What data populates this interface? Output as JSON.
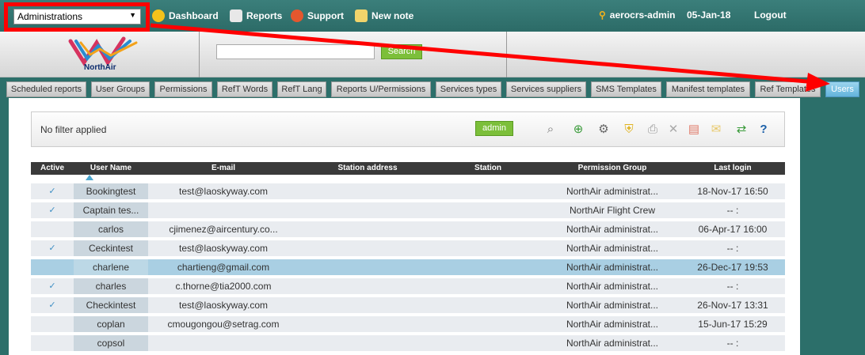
{
  "topbar": {
    "module_select": "Administrations",
    "dashboard": "Dashboard",
    "reports": "Reports",
    "support": "Support",
    "new_note": "New note",
    "user": "aerocrs-admin",
    "date": "05-Jan-18",
    "logout": "Logout"
  },
  "logo": {
    "brand": "NorthAir"
  },
  "search": {
    "button": "Search"
  },
  "tabs": [
    "Scheduled reports",
    "User Groups",
    "Permissions",
    "RefT Words",
    "RefT Lang",
    "Reports U/Permissions",
    "Services types",
    "Services suppliers",
    "SMS Templates",
    "Manifest templates",
    "Ref Templates",
    "Users"
  ],
  "filter": {
    "text": "No filter applied",
    "admin_button": "admin"
  },
  "table": {
    "headers": [
      "Active",
      "User Name",
      "E-mail",
      "Station address",
      "Station",
      "Permission Group",
      "Last login"
    ],
    "rows": [
      {
        "active": "✓",
        "user": "Bookingtest",
        "email": "test@laoskyway.com",
        "group": "NorthAir administrat...",
        "last": "18-Nov-17 16:50"
      },
      {
        "active": "✓",
        "user": "Captain tes...",
        "email": "",
        "group": "NorthAir Flight Crew",
        "last": "-- :"
      },
      {
        "active": "",
        "user": "carlos",
        "email": "cjimenez@aircentury.co...",
        "group": "NorthAir administrat...",
        "last": "06-Apr-17 16:00"
      },
      {
        "active": "✓",
        "user": "Ceckintest",
        "email": "test@laoskyway.com",
        "group": "NorthAir administrat...",
        "last": "-- :"
      },
      {
        "active": "",
        "user": "charlene",
        "email": "chartieng@gmail.com",
        "group": "NorthAir administrat...",
        "last": "26-Dec-17 19:53"
      },
      {
        "active": "✓",
        "user": "charles",
        "email": "c.thorne@tia2000.com",
        "group": "NorthAir administrat...",
        "last": "-- :"
      },
      {
        "active": "✓",
        "user": "Checkintest",
        "email": "test@laoskyway.com",
        "group": "NorthAir administrat...",
        "last": "26-Nov-17 13:31"
      },
      {
        "active": "",
        "user": "coplan",
        "email": "cmougongou@setrag.com",
        "group": "NorthAir administrat...",
        "last": "15-Jun-17 15:29"
      },
      {
        "active": "",
        "user": "copsol",
        "email": "",
        "group": "NorthAir administrat...",
        "last": "-- :"
      }
    ]
  },
  "colors": {
    "accent_green": "#7cbf3a",
    "active_tab": "#63b4dc",
    "annotation_red": "#ff0000"
  }
}
